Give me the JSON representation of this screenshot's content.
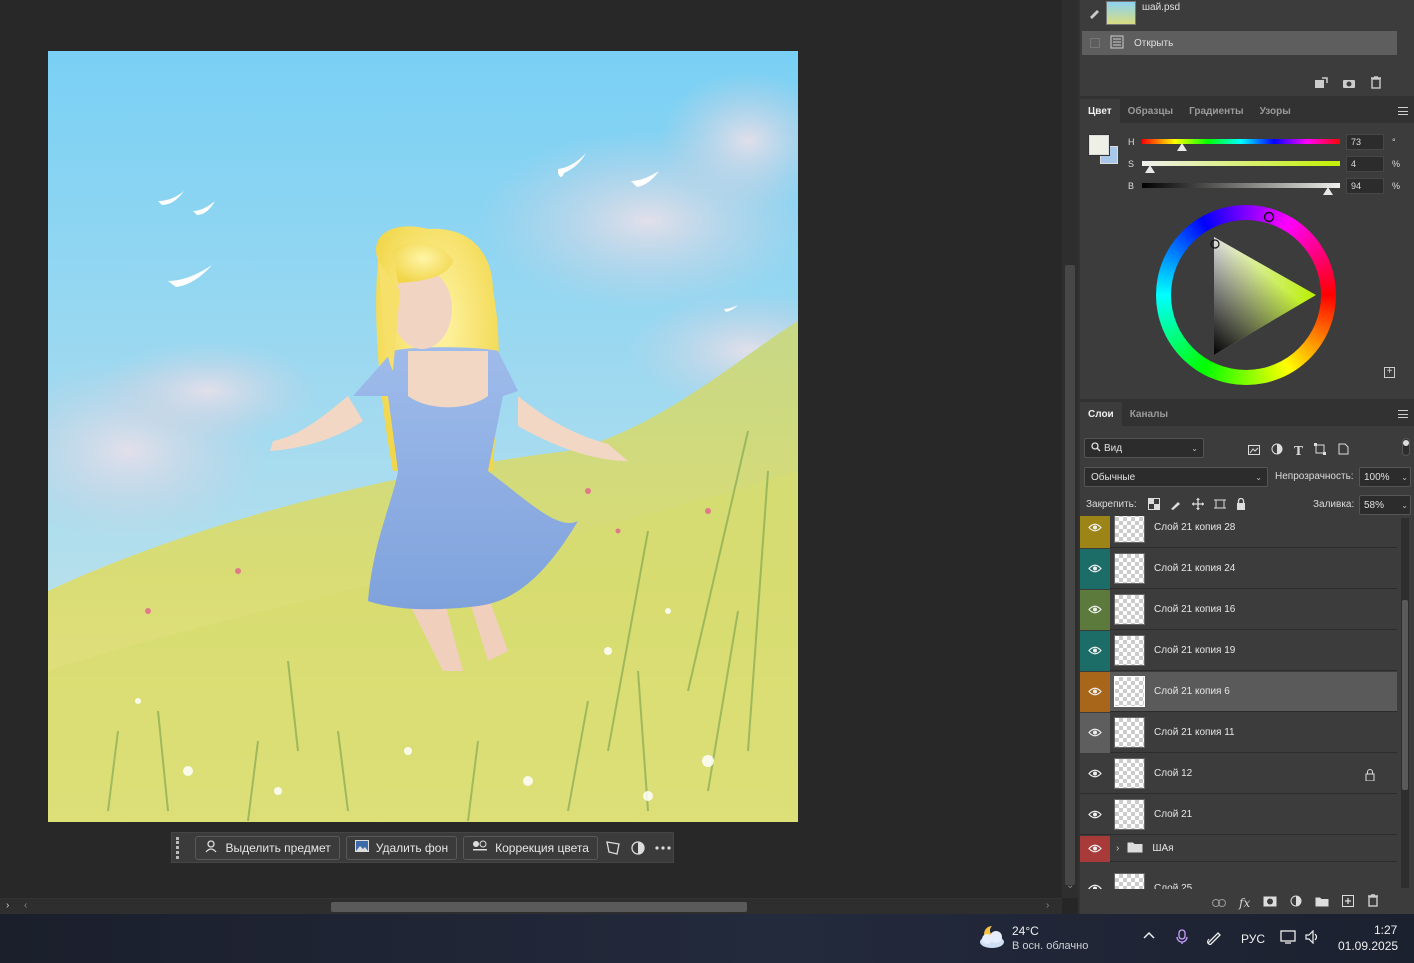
{
  "history": {
    "snapshot_label": "шай.psd",
    "items": [
      {
        "label": "Открыть"
      }
    ]
  },
  "color_panel": {
    "tabs": [
      "Цвет",
      "Образцы",
      "Градиенты",
      "Узоры"
    ],
    "hsb": [
      {
        "label": "H",
        "value": "73",
        "unit": "°"
      },
      {
        "label": "S",
        "value": "4",
        "unit": "%"
      },
      {
        "label": "B",
        "value": "94",
        "unit": "%"
      }
    ],
    "hue_level": 0.2,
    "sat_level": 0.04,
    "bri_level": 0.94,
    "foreground_color": "#eeefe6",
    "background_color": "#a8c8ea"
  },
  "layers_panel": {
    "tabs": [
      "Слои",
      "Каналы"
    ],
    "filter_label": "Вид",
    "blend_mode": "Обычные",
    "opacity_label": "Непрозрачность:",
    "opacity_value": "100%",
    "lock_label": "Закрепить:",
    "fill_label": "Заливка:",
    "fill_value": "58%",
    "layers": [
      {
        "name": "Слой 21 копия 28",
        "color": "#9c8416",
        "selected": false
      },
      {
        "name": "Слой 21 копия 24",
        "color": "#1c6c67",
        "selected": false
      },
      {
        "name": "Слой 21 копия 16",
        "color": "#5c7a3b",
        "selected": false
      },
      {
        "name": "Слой 21 копия 19",
        "color": "#1c6c67",
        "selected": false
      },
      {
        "name": "Слой 21 копия 6",
        "color": "#a8661a",
        "selected": true
      },
      {
        "name": "Слой 21 копия 11",
        "color": "#5e5e5e",
        "selected": false
      },
      {
        "name": "Слой 12",
        "color": "",
        "selected": false,
        "locked": true
      },
      {
        "name": "Слой 21",
        "color": "",
        "selected": false
      },
      {
        "name": "ШАя",
        "color": "#a83a3a",
        "selected": false,
        "group": true
      },
      {
        "name": "Слой 25",
        "color": "",
        "selected": false
      }
    ]
  },
  "context_bar": {
    "select_subject": "Выделить предмет",
    "remove_bg": "Удалить фон",
    "color_correction": "Коррекция цвета"
  },
  "taskbar": {
    "temperature": "24°C",
    "weather": "В осн. облачно",
    "language": "РУС",
    "time": "1:27",
    "date": "01.09.2025"
  }
}
